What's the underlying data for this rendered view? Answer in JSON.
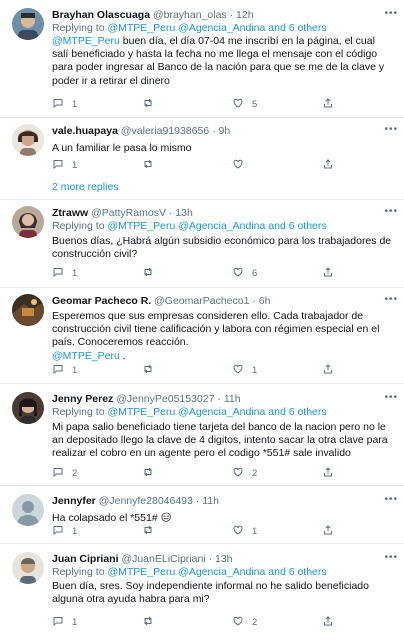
{
  "tweets": [
    {
      "name": "Brayhan Olascuaga",
      "handle": "@brayhan_olas",
      "time": "12h",
      "reply_prefix": "Replying to ",
      "reply_to": "@MTPE_Peru @Agencia_Andina and 6 others",
      "mention": "@MTPE_Peru",
      "text": " buen día, el día 07-04 me inscribí en la página, el cual salí beneficiado y hasta la fecha no me llega el mensaje con el código para poder ingresar al Banco de la nación para que se me de la clave y poder ir a retirar el dinero",
      "replies": "1",
      "retweets": "",
      "likes": "5"
    },
    {
      "name": "vale.huapaya",
      "handle": "@valeria91938656",
      "time": "9h",
      "text": "A un familiar le pasa lo mismo",
      "replies": "1",
      "retweets": "",
      "likes": "",
      "show_more": "2 more replies"
    },
    {
      "name": "Ztraww",
      "handle": "@PattyRamosV",
      "time": "13h",
      "reply_prefix": "Replying to ",
      "reply_to": "@MTPE_Peru @Agencia_Andina and 6 others",
      "text": "Buenos días, ¿Habrá algún subsidio económico para los trabajadores de construcción civil?",
      "replies": "1",
      "retweets": "",
      "likes": "6"
    },
    {
      "name": "Geomar Pacheco R.",
      "handle": "@GeomarPacheco1",
      "time": "6h",
      "text": "Esperemos que sus empresas consideren ello. Cada trabajador de construcción civil tiene calificación y labora con régimen especial en el país. Conoceremos reacción.",
      "mention_after": "@MTPE_Peru",
      "text_after": " .",
      "replies": "1",
      "retweets": "",
      "likes": "1"
    },
    {
      "name": "Jenny Perez",
      "handle": "@JennyPe05153027",
      "time": "11h",
      "reply_prefix": "Replying to ",
      "reply_to": "@MTPE_Peru @Agencia_Andina and 6 others",
      "text": "Mi papa salio beneficiado tiene tarjeta del banco de la nacion pero no le an depositado llego la clave de 4 digitos, intento sacar la otra clave para realizar el cobro en un agente pero el codigo *551# sale invalido",
      "replies": "2",
      "retweets": "",
      "likes": "2"
    },
    {
      "name": "Jennyfer",
      "handle": "@Jennyfe28046493",
      "time": "11h",
      "text": "Ha colapsado el *551# 😑",
      "replies": "1",
      "retweets": "",
      "likes": "1"
    },
    {
      "name": "Juan Cipriani",
      "handle": "@JuanELiCipriani",
      "time": "13h",
      "reply_prefix": "Replying to ",
      "reply_to": "@MTPE_Peru @Agencia_Andina and 6 others",
      "text": "Buen día, sres. Soy independiente informal no he salido beneficiado alguna otra ayuda habra para mi?",
      "replies": "1",
      "retweets": "",
      "likes": "2"
    }
  ],
  "ui": {
    "dot": "·",
    "more_glyph": "•••",
    "colors": {
      "link": "#1b95e0",
      "muted": "#5b7083",
      "divider": "#e6ecf0"
    }
  },
  "icons": [
    "reply-icon",
    "retweet-icon",
    "like-icon",
    "share-icon",
    "more-options-icon"
  ]
}
